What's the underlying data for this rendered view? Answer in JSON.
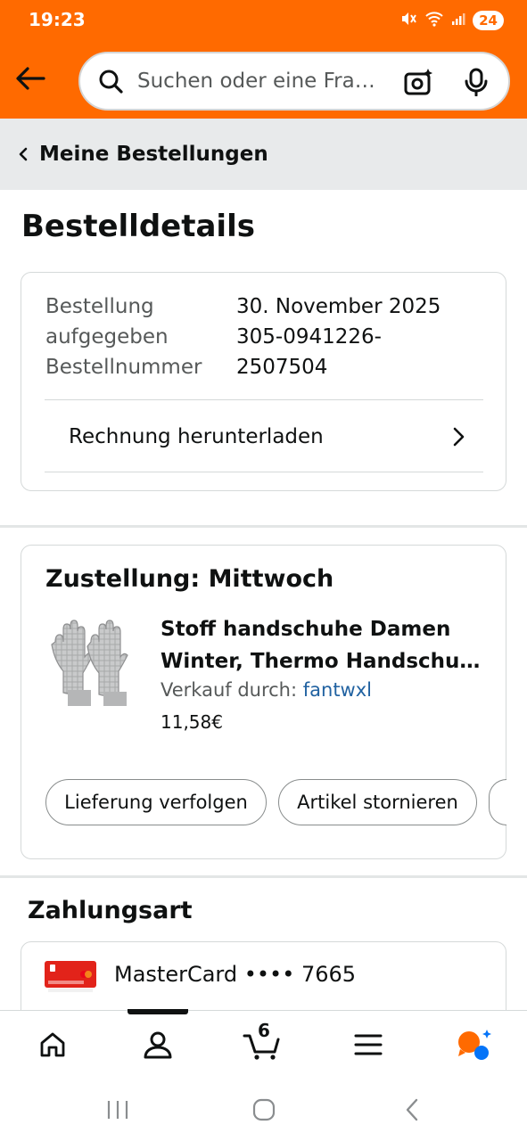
{
  "status_bar": {
    "time": "19:23",
    "battery": "24",
    "icons": [
      "mute-icon",
      "wifi-icon",
      "signal-icon",
      "battery-icon"
    ]
  },
  "header": {
    "back_icon": "arrow-left-icon",
    "search_placeholder": "Suchen oder eine Fra…",
    "icons": [
      "search-icon",
      "camera-lens-icon",
      "microphone-icon"
    ]
  },
  "breadcrumb": {
    "label": "Meine Bestellungen"
  },
  "page_title": "Bestelldetails",
  "order_info": {
    "placed_label_1": "Bestellung",
    "placed_label_2": "aufgegeben",
    "placed_value": "30. November 2025",
    "number_label": "Bestellnummer",
    "number_value_1": "305-0941226-",
    "number_value_2": "2507504",
    "invoice_label": "Rechnung herunterladen"
  },
  "delivery": {
    "heading": "Zustellung: Mittwoch",
    "product": {
      "title_line1": "Stoff handschuhe Damen",
      "title_line2": "Winter, Thermo Handschu…",
      "sold_by_label": "Verkauf durch: ",
      "seller": "fantwxl",
      "price": "11,58€"
    },
    "buttons": {
      "track": "Lieferung verfolgen",
      "cancel": "Artikel stornieren"
    }
  },
  "payment": {
    "heading": "Zahlungsart",
    "card_label": "MasterCard •••• 7665"
  },
  "bottom_nav": {
    "items": [
      "home-icon",
      "account-icon",
      "cart-icon",
      "menu-icon",
      "rufus-ai-icon"
    ],
    "cart_count": "6",
    "active_index": 1
  },
  "colors": {
    "header_orange": "#ff6a00",
    "link_blue": "#2162a1",
    "breadcrumb_gray": "#e8eaeb",
    "ai_orange": "#ff6a00",
    "ai_blue": "#0574f8"
  }
}
